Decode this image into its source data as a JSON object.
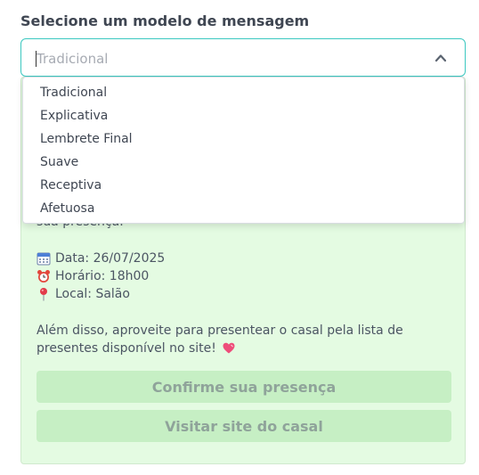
{
  "form": {
    "label": "Selecione um modelo de mensagem",
    "select_value": "Tradicional"
  },
  "dropdown": {
    "options": [
      "Tradicional",
      "Explicativa",
      "Lembrete Final",
      "Suave",
      "Receptiva",
      "Afetuosa"
    ]
  },
  "preview": {
    "cut_text": "sua presença.",
    "date": "Data: 26/07/2025",
    "time": "Horário: 18h00",
    "place": "Local: Salão",
    "paragraph": "Além disso, aproveite para presentear o casal pela lista de presentes disponível no site!",
    "confirm_button": "Confirme sua presença",
    "visit_button": "Visitar site do casal"
  },
  "icons": {
    "date": "calendar-icon",
    "time": "alarm-clock-icon",
    "place": "location-pin-icon",
    "heart": "heart-icon",
    "chevron": "chevron-up-icon"
  },
  "colors": {
    "select_border": "#3cc8c0",
    "preview_bg": "#e4fbe2",
    "button_bg": "#c6efc4"
  }
}
